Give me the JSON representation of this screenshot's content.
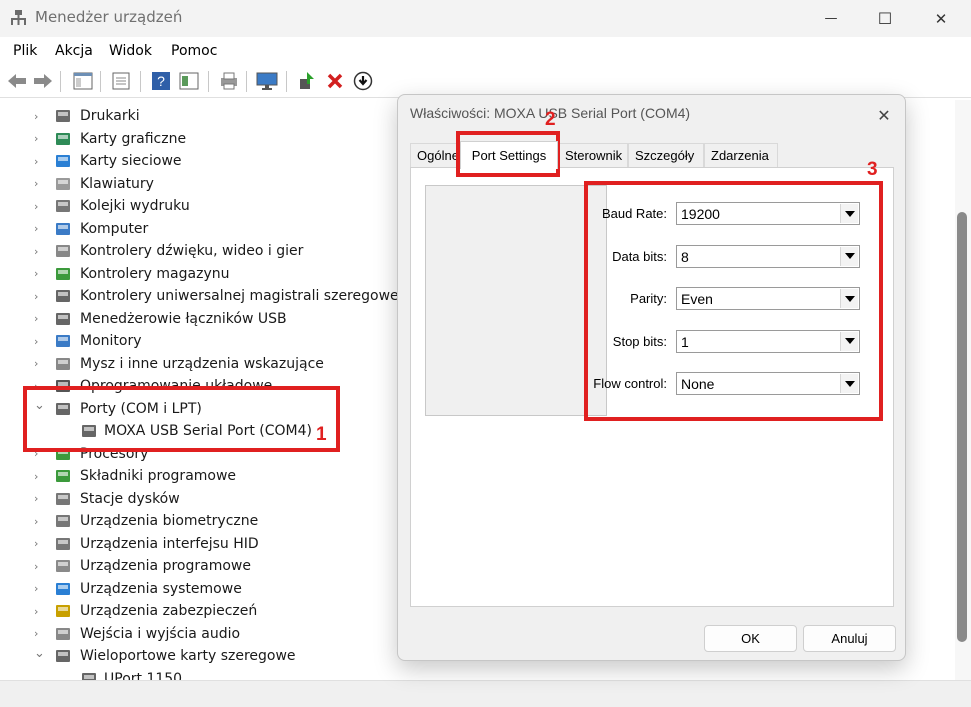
{
  "window": {
    "title": "Menedżer urządzeń",
    "minimize_glyph": "—",
    "maximize_glyph": "☐",
    "close_glyph": "✕"
  },
  "menu": {
    "items": [
      "Plik",
      "Akcja",
      "Widok",
      "Pomoc"
    ]
  },
  "toolbar": {
    "icons": [
      "back-icon",
      "forward-icon",
      "properties-view-icon",
      "console-icon",
      "help-icon",
      "scan-icon",
      "print-icon",
      "monitor-icon",
      "update-driver-icon",
      "uninstall-icon",
      "disable-icon"
    ]
  },
  "tree": {
    "nodes": [
      {
        "label": "Drukarki",
        "icon": "printer-icon",
        "expanded": false
      },
      {
        "label": "Karty graficzne",
        "icon": "display-adapter-icon",
        "expanded": false
      },
      {
        "label": "Karty sieciowe",
        "icon": "network-adapter-icon",
        "expanded": false
      },
      {
        "label": "Klawiatury",
        "icon": "keyboard-icon",
        "expanded": false
      },
      {
        "label": "Kolejki wydruku",
        "icon": "print-queue-icon",
        "expanded": false
      },
      {
        "label": "Komputer",
        "icon": "computer-icon",
        "expanded": false
      },
      {
        "label": "Kontrolery dźwięku, wideo i gier",
        "icon": "speaker-icon",
        "expanded": false
      },
      {
        "label": "Kontrolery magazynu",
        "icon": "storage-controller-icon",
        "expanded": false
      },
      {
        "label": "Kontrolery uniwersalnej magistrali szeregowej",
        "icon": "usb-icon",
        "expanded": false
      },
      {
        "label": "Menedżerowie łączników USB",
        "icon": "usb-connector-icon",
        "expanded": false
      },
      {
        "label": "Monitory",
        "icon": "monitor-icon",
        "expanded": false
      },
      {
        "label": "Mysz i inne urządzenia wskazujące",
        "icon": "mouse-icon",
        "expanded": false
      },
      {
        "label": "Oprogramowanie układowe",
        "icon": "firmware-icon",
        "expanded": false
      },
      {
        "label": "Porty (COM i LPT)",
        "icon": "port-icon",
        "expanded": true
      },
      {
        "label": "MOXA USB Serial Port (COM4)",
        "icon": "port-icon",
        "child": true
      },
      {
        "label": "Procesory",
        "icon": "processor-icon",
        "expanded": false
      },
      {
        "label": "Składniki programowe",
        "icon": "software-component-icon",
        "expanded": false
      },
      {
        "label": "Stacje dysków",
        "icon": "disk-drive-icon",
        "expanded": false
      },
      {
        "label": "Urządzenia biometryczne",
        "icon": "fingerprint-icon",
        "expanded": false
      },
      {
        "label": "Urządzenia interfejsu HID",
        "icon": "hid-icon",
        "expanded": false
      },
      {
        "label": "Urządzenia programowe",
        "icon": "software-device-icon",
        "expanded": false
      },
      {
        "label": "Urządzenia systemowe",
        "icon": "system-device-icon",
        "expanded": false
      },
      {
        "label": "Urządzenia zabezpieczeń",
        "icon": "security-device-icon",
        "expanded": false
      },
      {
        "label": "Wejścia i wyjścia audio",
        "icon": "audio-io-icon",
        "expanded": false
      },
      {
        "label": "Wieloportowe karty szeregowe",
        "icon": "port-icon",
        "expanded": true
      },
      {
        "label": "UPort 1150",
        "icon": "port-icon",
        "child": true
      }
    ]
  },
  "dialog": {
    "title": "Właściwości: MOXA USB Serial Port (COM4)",
    "close_glyph": "✕",
    "tabs": [
      {
        "label": "Ogólne",
        "active": false
      },
      {
        "label": "Port Settings",
        "active": true
      },
      {
        "label": "Sterownik",
        "active": false
      },
      {
        "label": "Szczegóły",
        "active": false
      },
      {
        "label": "Zdarzenia",
        "active": false
      }
    ],
    "fields": [
      {
        "label": "Baud Rate:",
        "value": "19200"
      },
      {
        "label": "Data bits:",
        "value": "8"
      },
      {
        "label": "Parity:",
        "value": "Even"
      },
      {
        "label": "Stop bits:",
        "value": "1"
      },
      {
        "label": "Flow control:",
        "value": "None"
      }
    ],
    "ok_label": "OK",
    "cancel_label": "Anuluj"
  },
  "annotations": {
    "labels": [
      "1",
      "2",
      "3"
    ],
    "color": "#e02020"
  }
}
